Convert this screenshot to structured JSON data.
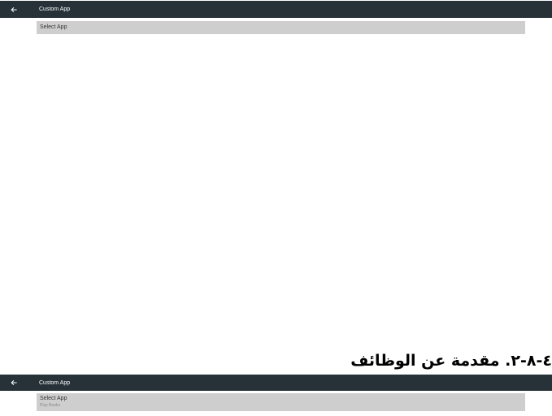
{
  "top_screen": {
    "app_bar": {
      "back_icon": "arrow-left-icon",
      "title": "Custom App",
      "background_color": "#263238"
    },
    "select_row": {
      "label": "Select App",
      "background_color": "#cecece"
    }
  },
  "document": {
    "heading": "٤-٨-٢. مقدمة عن الوظائف"
  },
  "bottom_screen": {
    "app_bar": {
      "back_icon": "arrow-left-icon",
      "title": "Custom App",
      "background_color": "#263238"
    },
    "select_row": {
      "label": "Select App",
      "value": "Play Books",
      "background_color": "#cecece"
    }
  }
}
